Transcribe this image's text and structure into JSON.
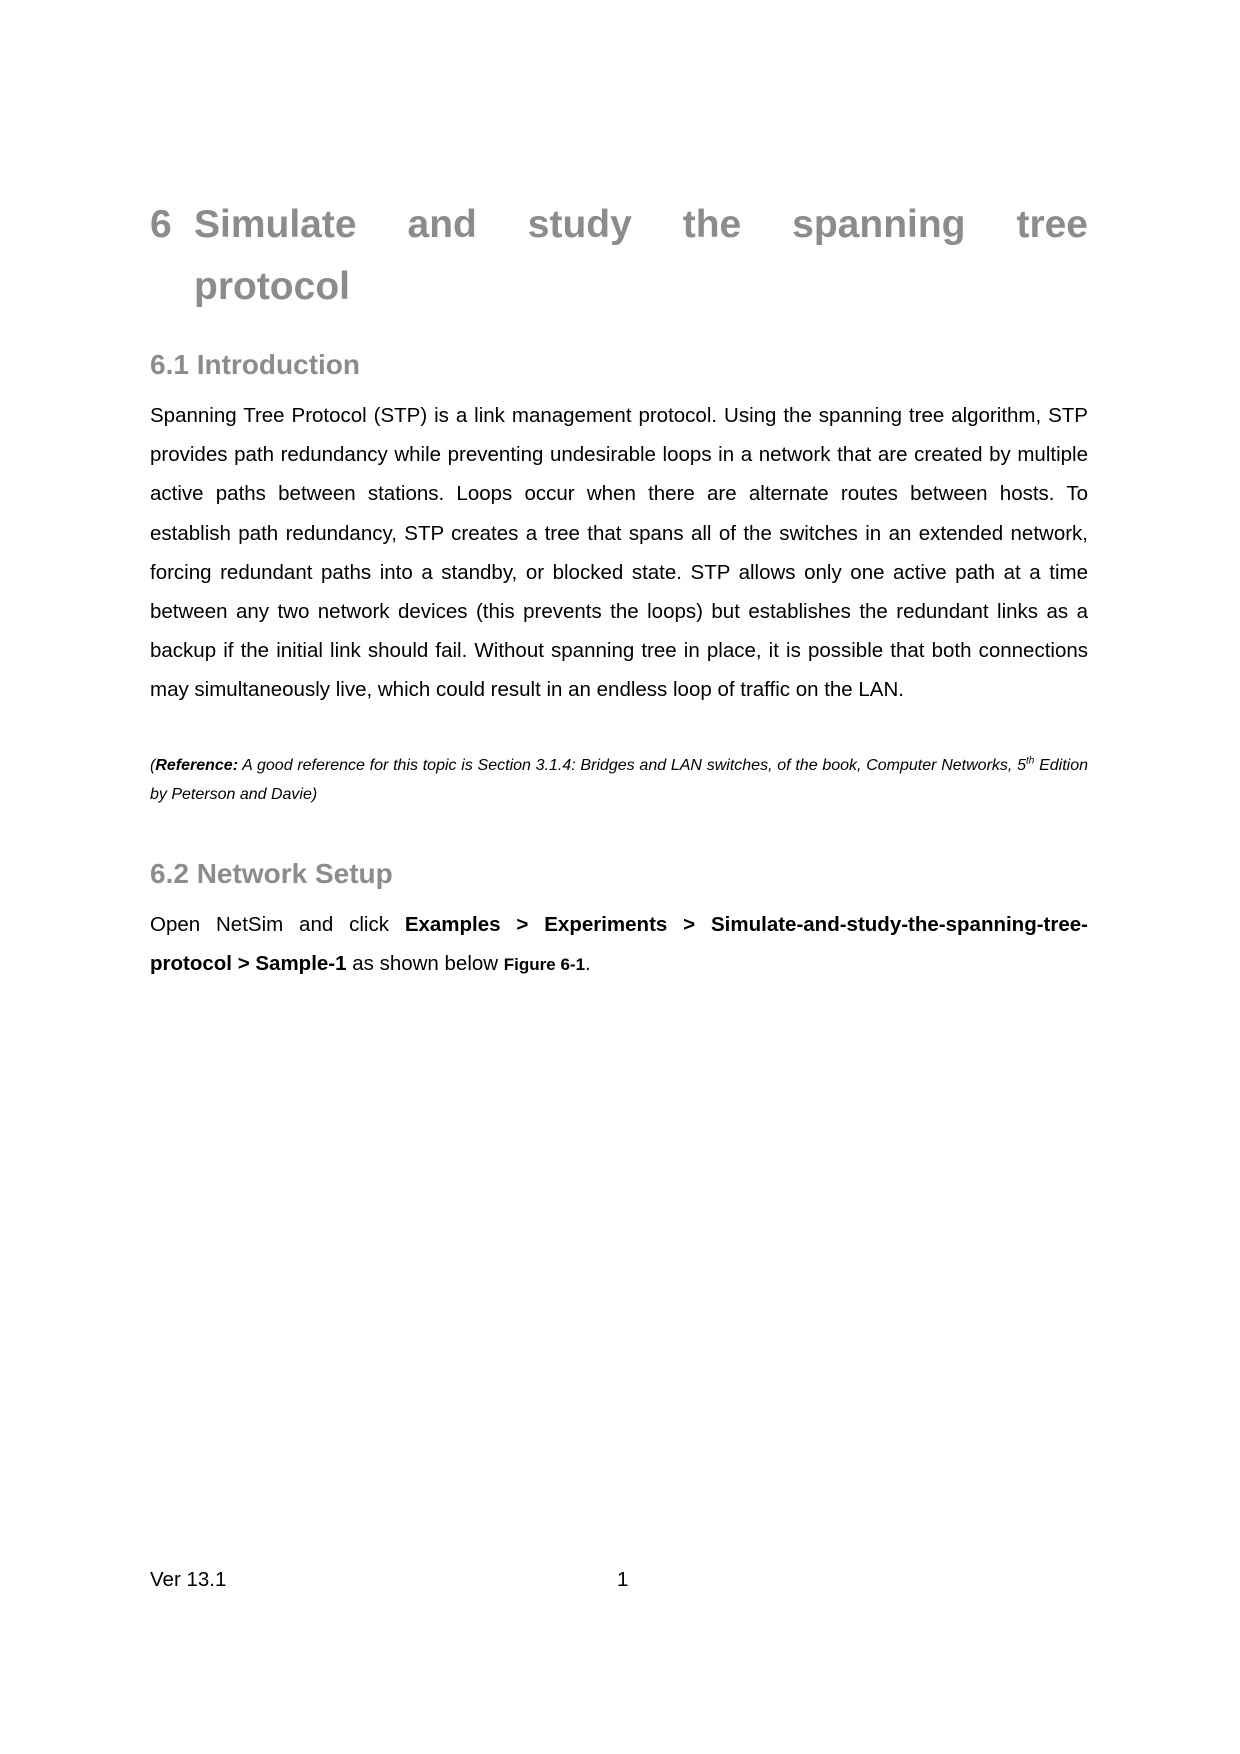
{
  "chapter": {
    "number": "6",
    "title_line1_words": [
      "Simulate",
      "and",
      "study",
      "the",
      "spanning",
      "tree"
    ],
    "title_line2": "protocol"
  },
  "sections": [
    {
      "heading": "6.1 Introduction",
      "paragraph": "Spanning Tree Protocol (STP) is a link management protocol. Using the spanning tree algorithm, STP provides path redundancy while preventing undesirable loops in a network that are created by multiple active paths between stations. Loops occur when there are alternate routes between hosts. To establish path redundancy, STP creates a tree that spans all of the switches in an extended network, forcing redundant paths into a standby, or blocked state. STP allows only one active path at a time between any two network devices (this prevents the loops) but establishes the redundant links as a backup if the initial link should fail. Without spanning tree in place, it is possible that both connections may simultaneously live, which could result in an endless loop of traffic on the LAN.",
      "reference": {
        "open_paren": "(",
        "label": "Reference:",
        "text_before_sup": " A good reference for this topic is Section 3.1.4: Bridges and LAN switches, of the book, Computer Networks, 5",
        "sup": "th",
        "text_after_sup": " Edition by Peterson and Davie)"
      }
    },
    {
      "heading": "6.2 Network Setup",
      "paragraph_parts": {
        "intro": "Open NetSim and click ",
        "path": [
          "Examples",
          "Experiments",
          "Simulate-and-study-the-spanning-tree-protocol",
          "Sample-1"
        ],
        "separator": " > ",
        "suffix": " as shown below ",
        "figure_ref": "Figure 6-1",
        "end": "."
      }
    }
  ],
  "footer": {
    "version": "Ver 13.1",
    "page_number": "1"
  }
}
